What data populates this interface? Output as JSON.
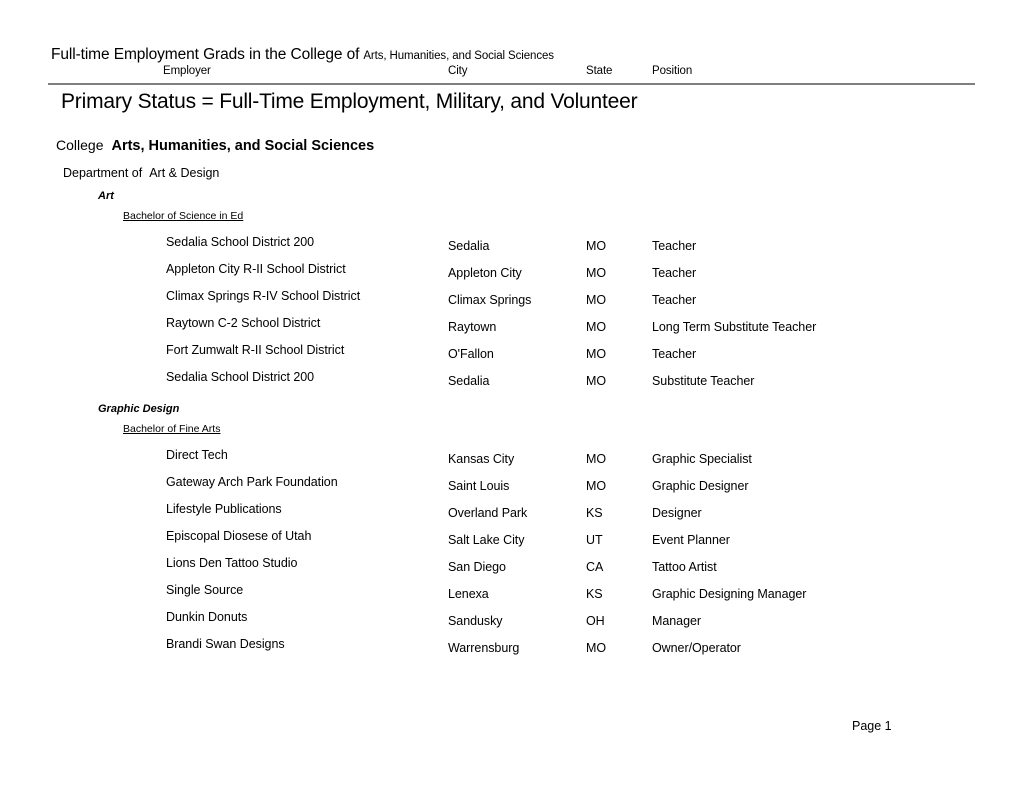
{
  "report_header": {
    "title": "Full-time Employment Grads in the College of",
    "college": "Arts, Humanities, and Social Sciences",
    "columns": {
      "employer": "Employer",
      "city": "City",
      "state": "State",
      "position": "Position"
    }
  },
  "main_title": "Primary Status = Full-Time Employment, Military, and Volunteer",
  "college": {
    "label": "College",
    "value": "Arts, Humanities, and Social Sciences"
  },
  "department": {
    "label": "Department of",
    "value": "Art & Design"
  },
  "groups": [
    {
      "major": "Art",
      "degree": "Bachelor of Science in Ed",
      "rows": [
        {
          "employer": "Sedalia School District 200",
          "city": "Sedalia",
          "state": "MO",
          "position": "Teacher"
        },
        {
          "employer": "Appleton City R-II School District",
          "city": "Appleton City",
          "state": "MO",
          "position": "Teacher"
        },
        {
          "employer": "Climax Springs R-IV School District",
          "city": "Climax Springs",
          "state": "MO",
          "position": "Teacher"
        },
        {
          "employer": "Raytown C-2 School District",
          "city": "Raytown",
          "state": "MO",
          "position": "Long Term Substitute Teacher"
        },
        {
          "employer": "Fort Zumwalt R-II School District",
          "city": "O'Fallon",
          "state": "MO",
          "position": "Teacher"
        },
        {
          "employer": "Sedalia School District 200",
          "city": "Sedalia",
          "state": "MO",
          "position": "Substitute Teacher"
        }
      ]
    },
    {
      "major": "Graphic Design",
      "degree": "Bachelor of Fine Arts",
      "rows": [
        {
          "employer": "Direct Tech",
          "city": "Kansas City",
          "state": "MO",
          "position": "Graphic Specialist"
        },
        {
          "employer": "Gateway Arch Park Foundation",
          "city": "Saint Louis",
          "state": "MO",
          "position": "Graphic Designer"
        },
        {
          "employer": "Lifestyle Publications",
          "city": "Overland Park",
          "state": "KS",
          "position": "Designer"
        },
        {
          "employer": "Episcopal Diosese of Utah",
          "city": "Salt Lake City",
          "state": "UT",
          "position": "Event Planner"
        },
        {
          "employer": "Lions Den Tattoo Studio",
          "city": "San Diego",
          "state": "CA",
          "position": "Tattoo Artist"
        },
        {
          "employer": "Single Source",
          "city": "Lenexa",
          "state": "KS",
          "position": "Graphic Designing Manager"
        },
        {
          "employer": "Dunkin Donuts",
          "city": "Sandusky",
          "state": "OH",
          "position": "Manager"
        },
        {
          "employer": "Brandi Swan Designs",
          "city": "Warrensburg",
          "state": "MO",
          "position": "Owner/Operator"
        }
      ]
    }
  ],
  "footer": {
    "page_label": "Page 1"
  },
  "colors": {
    "text": "#000000",
    "rule": "#7f7f7f",
    "background": "#ffffff"
  }
}
